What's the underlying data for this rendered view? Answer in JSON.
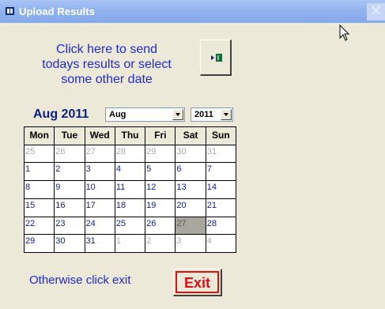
{
  "window": {
    "title": "Upload Results",
    "close_symbol": "✕"
  },
  "prompt": {
    "line1": "Click here to send",
    "line2": "todays results or select",
    "line3": "some other date"
  },
  "send_button": {
    "icon": "send-records-icon"
  },
  "calendar": {
    "label": "Aug 2011",
    "month_value": "Aug",
    "year_value": "2011",
    "weekdays": [
      "Mon",
      "Tue",
      "Wed",
      "Thu",
      "Fri",
      "Sat",
      "Sun"
    ],
    "days": [
      [
        "25",
        "26",
        "27",
        "28",
        "29",
        "30",
        "31"
      ],
      [
        "1",
        "2",
        "3",
        "4",
        "5",
        "6",
        "7"
      ],
      [
        "8",
        "9",
        "10",
        "11",
        "12",
        "13",
        "14"
      ],
      [
        "15",
        "16",
        "17",
        "18",
        "19",
        "20",
        "21"
      ],
      [
        "22",
        "23",
        "24",
        "25",
        "26",
        "27",
        "28"
      ],
      [
        "29",
        "30",
        "31",
        "1",
        "2",
        "3",
        "4"
      ]
    ],
    "selected_day": "27",
    "colors": {
      "current_month": "#0c1c9e",
      "other_month": "#a8a8a8",
      "selected_bg": "#a8a79d"
    }
  },
  "exit": {
    "text": "Otherwise click exit",
    "button_label": "Exit"
  },
  "colors": {
    "title_bar": "#90b3ef",
    "prompt_text": "#1e2ad9",
    "exit_red": "#e01010",
    "background": "#ece9d8"
  }
}
